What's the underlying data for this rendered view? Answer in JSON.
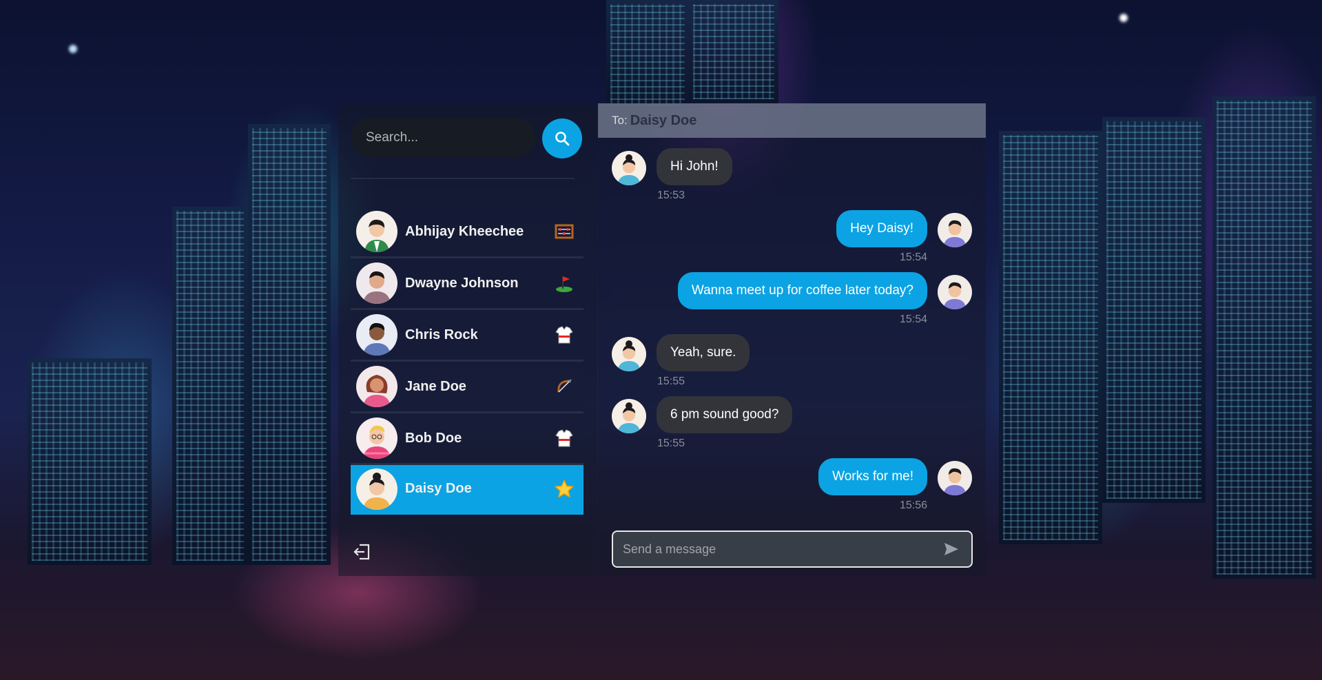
{
  "search": {
    "placeholder": "Search..."
  },
  "contacts": [
    {
      "name": "Abhijay Kheechee",
      "status_icon": "abacus-icon",
      "active": false
    },
    {
      "name": "Dwayne Johnson",
      "status_icon": "golf-flag-icon",
      "active": false
    },
    {
      "name": "Chris Rock",
      "status_icon": "martial-arts-uniform-icon",
      "active": false
    },
    {
      "name": "Jane Doe",
      "status_icon": "bow-and-arrow-icon",
      "active": false
    },
    {
      "name": "Bob Doe",
      "status_icon": "martial-arts-uniform-icon",
      "active": false
    },
    {
      "name": "Daisy Doe",
      "status_icon": "star-icon",
      "active": true
    }
  ],
  "chat": {
    "to_label": "To:",
    "to_name": "Daisy Doe",
    "messages": [
      {
        "side": "left",
        "text": "Hi John!",
        "time": "15:53"
      },
      {
        "side": "right",
        "text": "Hey Daisy!",
        "time": "15:54"
      },
      {
        "side": "right",
        "text": "Wanna meet up for coffee later today?",
        "time": "15:54"
      },
      {
        "side": "left",
        "text": "Yeah, sure.",
        "time": "15:55"
      },
      {
        "side": "left",
        "text": "6 pm sound good?",
        "time": "15:55"
      },
      {
        "side": "right",
        "text": "Works for me!",
        "time": "15:56"
      }
    ],
    "composer_placeholder": "Send a message"
  },
  "colors": {
    "accent": "#0ba3e3",
    "incoming_bubble": "#32343a"
  }
}
